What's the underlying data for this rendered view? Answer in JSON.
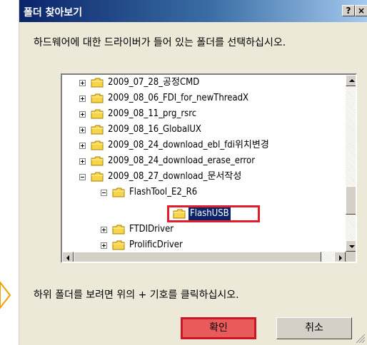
{
  "window": {
    "title": "폴더 찾아보기",
    "help_button": "?",
    "close_button": "×"
  },
  "instruction": "하드웨어에 대한 드라이버가 들어 있는 폴더를 선택하십시오.",
  "tree": {
    "items": [
      {
        "label": "2009_07_28_공정CMD",
        "level": 0,
        "expander": "plus"
      },
      {
        "label": "2009_08_06_FDI_for_newThreadX",
        "level": 0,
        "expander": "plus"
      },
      {
        "label": "2009_08_11_prg_rsrc",
        "level": 0,
        "expander": "plus"
      },
      {
        "label": "2009_08_16_GlobalUX",
        "level": 0,
        "expander": "plus"
      },
      {
        "label": "2009_08_24_download_ebl_fdi위치변경",
        "level": 0,
        "expander": "plus"
      },
      {
        "label": "2009_08_24_download_erase_error",
        "level": 0,
        "expander": "plus"
      },
      {
        "label": "2009_08_27_download_문서작성",
        "level": 0,
        "expander": "minus"
      },
      {
        "label": "FlashTool_E2_R6",
        "level": 1,
        "expander": "minus"
      },
      {
        "label": "FlashUSB",
        "level": 2,
        "expander": "none",
        "selected": true
      },
      {
        "label": "FTDIDriver",
        "level": 1,
        "expander": "plus"
      },
      {
        "label": "ProlificDriver",
        "level": 1,
        "expander": "plus"
      }
    ]
  },
  "hint": "하위 폴더를 보려면 위의 + 기호를 클릭하십시오.",
  "buttons": {
    "ok": "확인",
    "cancel": "취소"
  },
  "colors": {
    "title_start": "#0a246a",
    "title_end": "#a6caf0",
    "selection": "#0a246a",
    "highlight_border": "#e01e2b",
    "ok_fill": "#e95b5b",
    "pointer": "#f0a000"
  }
}
